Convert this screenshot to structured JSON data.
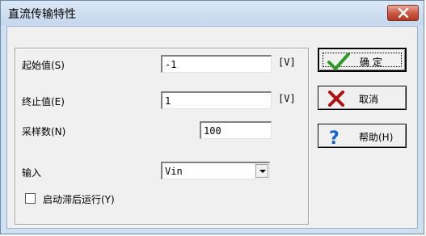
{
  "window": {
    "title": "直流传输特性"
  },
  "form": {
    "start": {
      "label": "起始值(S)",
      "value": "-1",
      "unit": "[V]"
    },
    "stop": {
      "label": "终止值(E)",
      "value": "1",
      "unit": "[V]"
    },
    "samples": {
      "label": "采样数(N)",
      "value": "100"
    },
    "input": {
      "label": "输入",
      "value": "Vin"
    },
    "hysteresis": {
      "label": "启动滞后运行(Y)",
      "checked": false
    }
  },
  "buttons": {
    "ok": {
      "label": "确 定",
      "icon": "check-icon"
    },
    "cancel": {
      "label": "取消",
      "icon": "x-icon"
    },
    "help": {
      "label": "帮助(H)",
      "icon": "question-icon"
    }
  },
  "colors": {
    "titlebar": "#c4d7ee",
    "close": "#c9553f",
    "check": "#2f9a27",
    "cancel_x": "#b01010",
    "help_q": "#1060d0"
  }
}
